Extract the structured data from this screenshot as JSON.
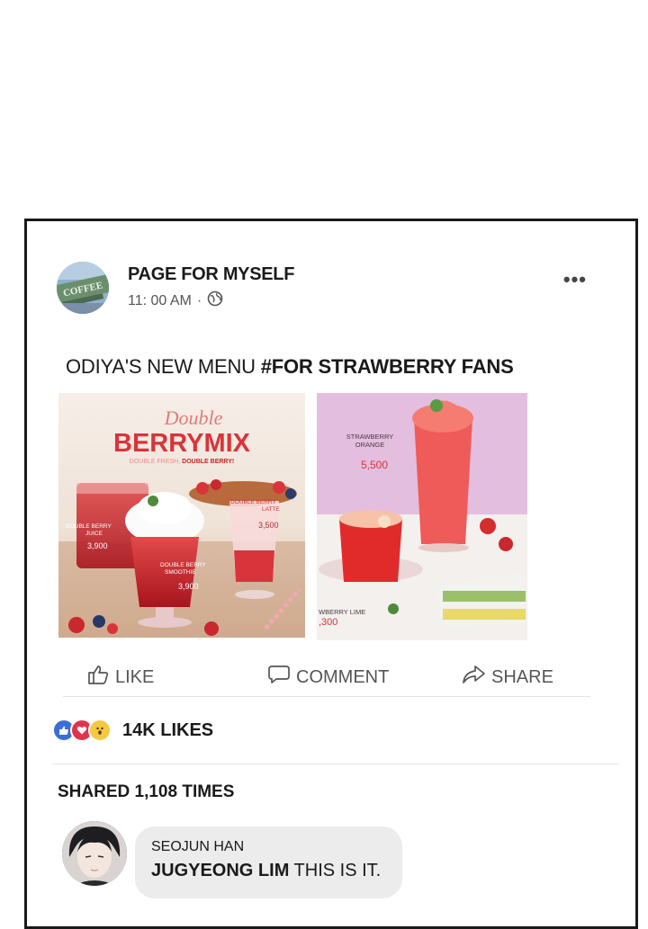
{
  "post": {
    "page_name": "PAGE FOR MYSELF",
    "time": "11: 00 AM",
    "separator": "·",
    "more_label": "•••",
    "avatar_text": "COFFEE",
    "caption_plain": "ODIYA'S NEW MENU ",
    "caption_tag": "#FOR STRAWBERRY FANS"
  },
  "photo_left": {
    "title_script": "Double",
    "title_main": "BERRYMIX",
    "tagline_a": "DOUBLE FRESH, ",
    "tagline_b": "DOUBLE BERRY!",
    "item1_name_1": "DOUBLE BERRY",
    "item1_name_2": "JUICE",
    "item1_price": "3,900",
    "item2_name_1": "DOUBLE BERRY",
    "item2_name_2": "SMOOTHIE",
    "item2_price": "3,900",
    "item3_name_1": "DOUBLE BERRY",
    "item3_name_2": "LATTE",
    "item3_price": "3,500"
  },
  "photo_right": {
    "item1_name_1": "STRAWBERRY",
    "item1_name_2": "ORANGE",
    "item1_price": "5,500",
    "item2_name": "WBERRY LIME",
    "item2_price": ",300"
  },
  "actions": {
    "like": "LIKE",
    "comment": "COMMENT",
    "share": "SHARE"
  },
  "reactions": {
    "count": "14K LIKES",
    "like_color": "#3b6fd8",
    "love_color": "#e0344e",
    "wow_color": "#f5c842"
  },
  "shares": "SHARED 1,108 TIMES",
  "comment": {
    "author": "SEOJUN HAN",
    "mention": "JUGYEONG LIM",
    "text": " THIS IS IT."
  }
}
